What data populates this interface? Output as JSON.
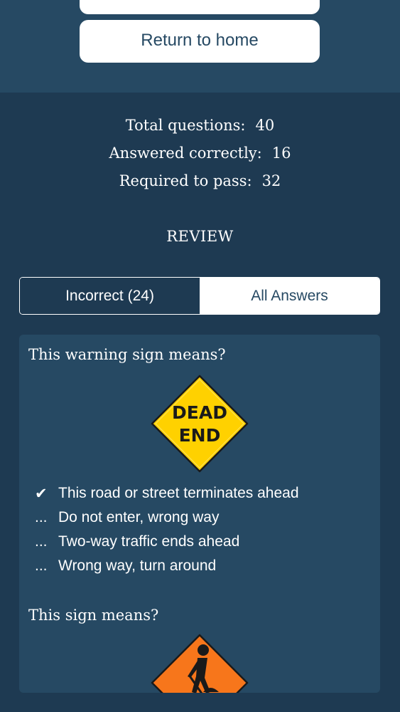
{
  "header": {
    "return_home_label": "Return to home"
  },
  "stats": {
    "total_questions_label": "Total questions:",
    "total_questions_value": "40",
    "answered_correctly_label": "Answered correctly:",
    "answered_correctly_value": "16",
    "required_to_pass_label": "Required to pass:",
    "required_to_pass_value": "32"
  },
  "review": {
    "title": "REVIEW",
    "tabs": [
      {
        "label": "Incorrect (24)",
        "selected": true
      },
      {
        "label": "All Answers",
        "selected": false
      }
    ]
  },
  "questions": [
    {
      "text": "This warning sign means?",
      "sign": {
        "icon": "dead-end-sign-icon",
        "lines": [
          "DEAD",
          "END"
        ],
        "color": "#ffd100"
      },
      "answers": [
        {
          "mark": "✔",
          "text": "This road or street terminates ahead"
        },
        {
          "mark": "...",
          "text": "Do not enter, wrong way"
        },
        {
          "mark": "...",
          "text": "Two-way traffic ends ahead"
        },
        {
          "mark": "...",
          "text": "Wrong way, turn around"
        }
      ]
    },
    {
      "text": "This sign means?",
      "sign": {
        "icon": "road-work-sign-icon",
        "color": "#f7761b"
      }
    }
  ],
  "colors": {
    "background": "#1e3a52",
    "panel": "#264963",
    "button_text": "#264963"
  }
}
